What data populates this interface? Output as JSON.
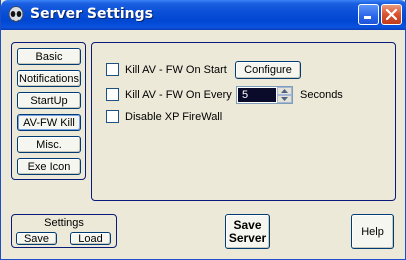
{
  "window": {
    "title": "Server Settings",
    "app_icon": "alien-head-icon",
    "minimize_icon": "minimize-icon",
    "close_icon": "close-icon"
  },
  "nav": {
    "items": [
      {
        "label": "Basic"
      },
      {
        "label": "Notifications"
      },
      {
        "label": "StartUp"
      },
      {
        "label": "AV-FW Kill",
        "selected": true
      },
      {
        "label": "Misc."
      },
      {
        "label": "Exe Icon"
      }
    ]
  },
  "content": {
    "kill_on_start": {
      "label": "Kill AV - FW On Start",
      "checked": false
    },
    "configure_label": "Configure",
    "kill_every": {
      "label": "Kill AV - FW On Every",
      "checked": false
    },
    "interval_value": "5",
    "seconds_label": "Seconds",
    "disable_xp_firewall": {
      "label": "Disable XP FireWall",
      "checked": false
    }
  },
  "settings": {
    "caption": "Settings",
    "save_label": "Save",
    "load_label": "Load"
  },
  "footer": {
    "save_server_line1": "Save",
    "save_server_line2": "Server",
    "help_label": "Help"
  },
  "colors": {
    "titlebar": "#0047d1",
    "window_bg": "#ece9d8",
    "group_border": "#0a1a7a",
    "close_button": "#d9532f"
  }
}
